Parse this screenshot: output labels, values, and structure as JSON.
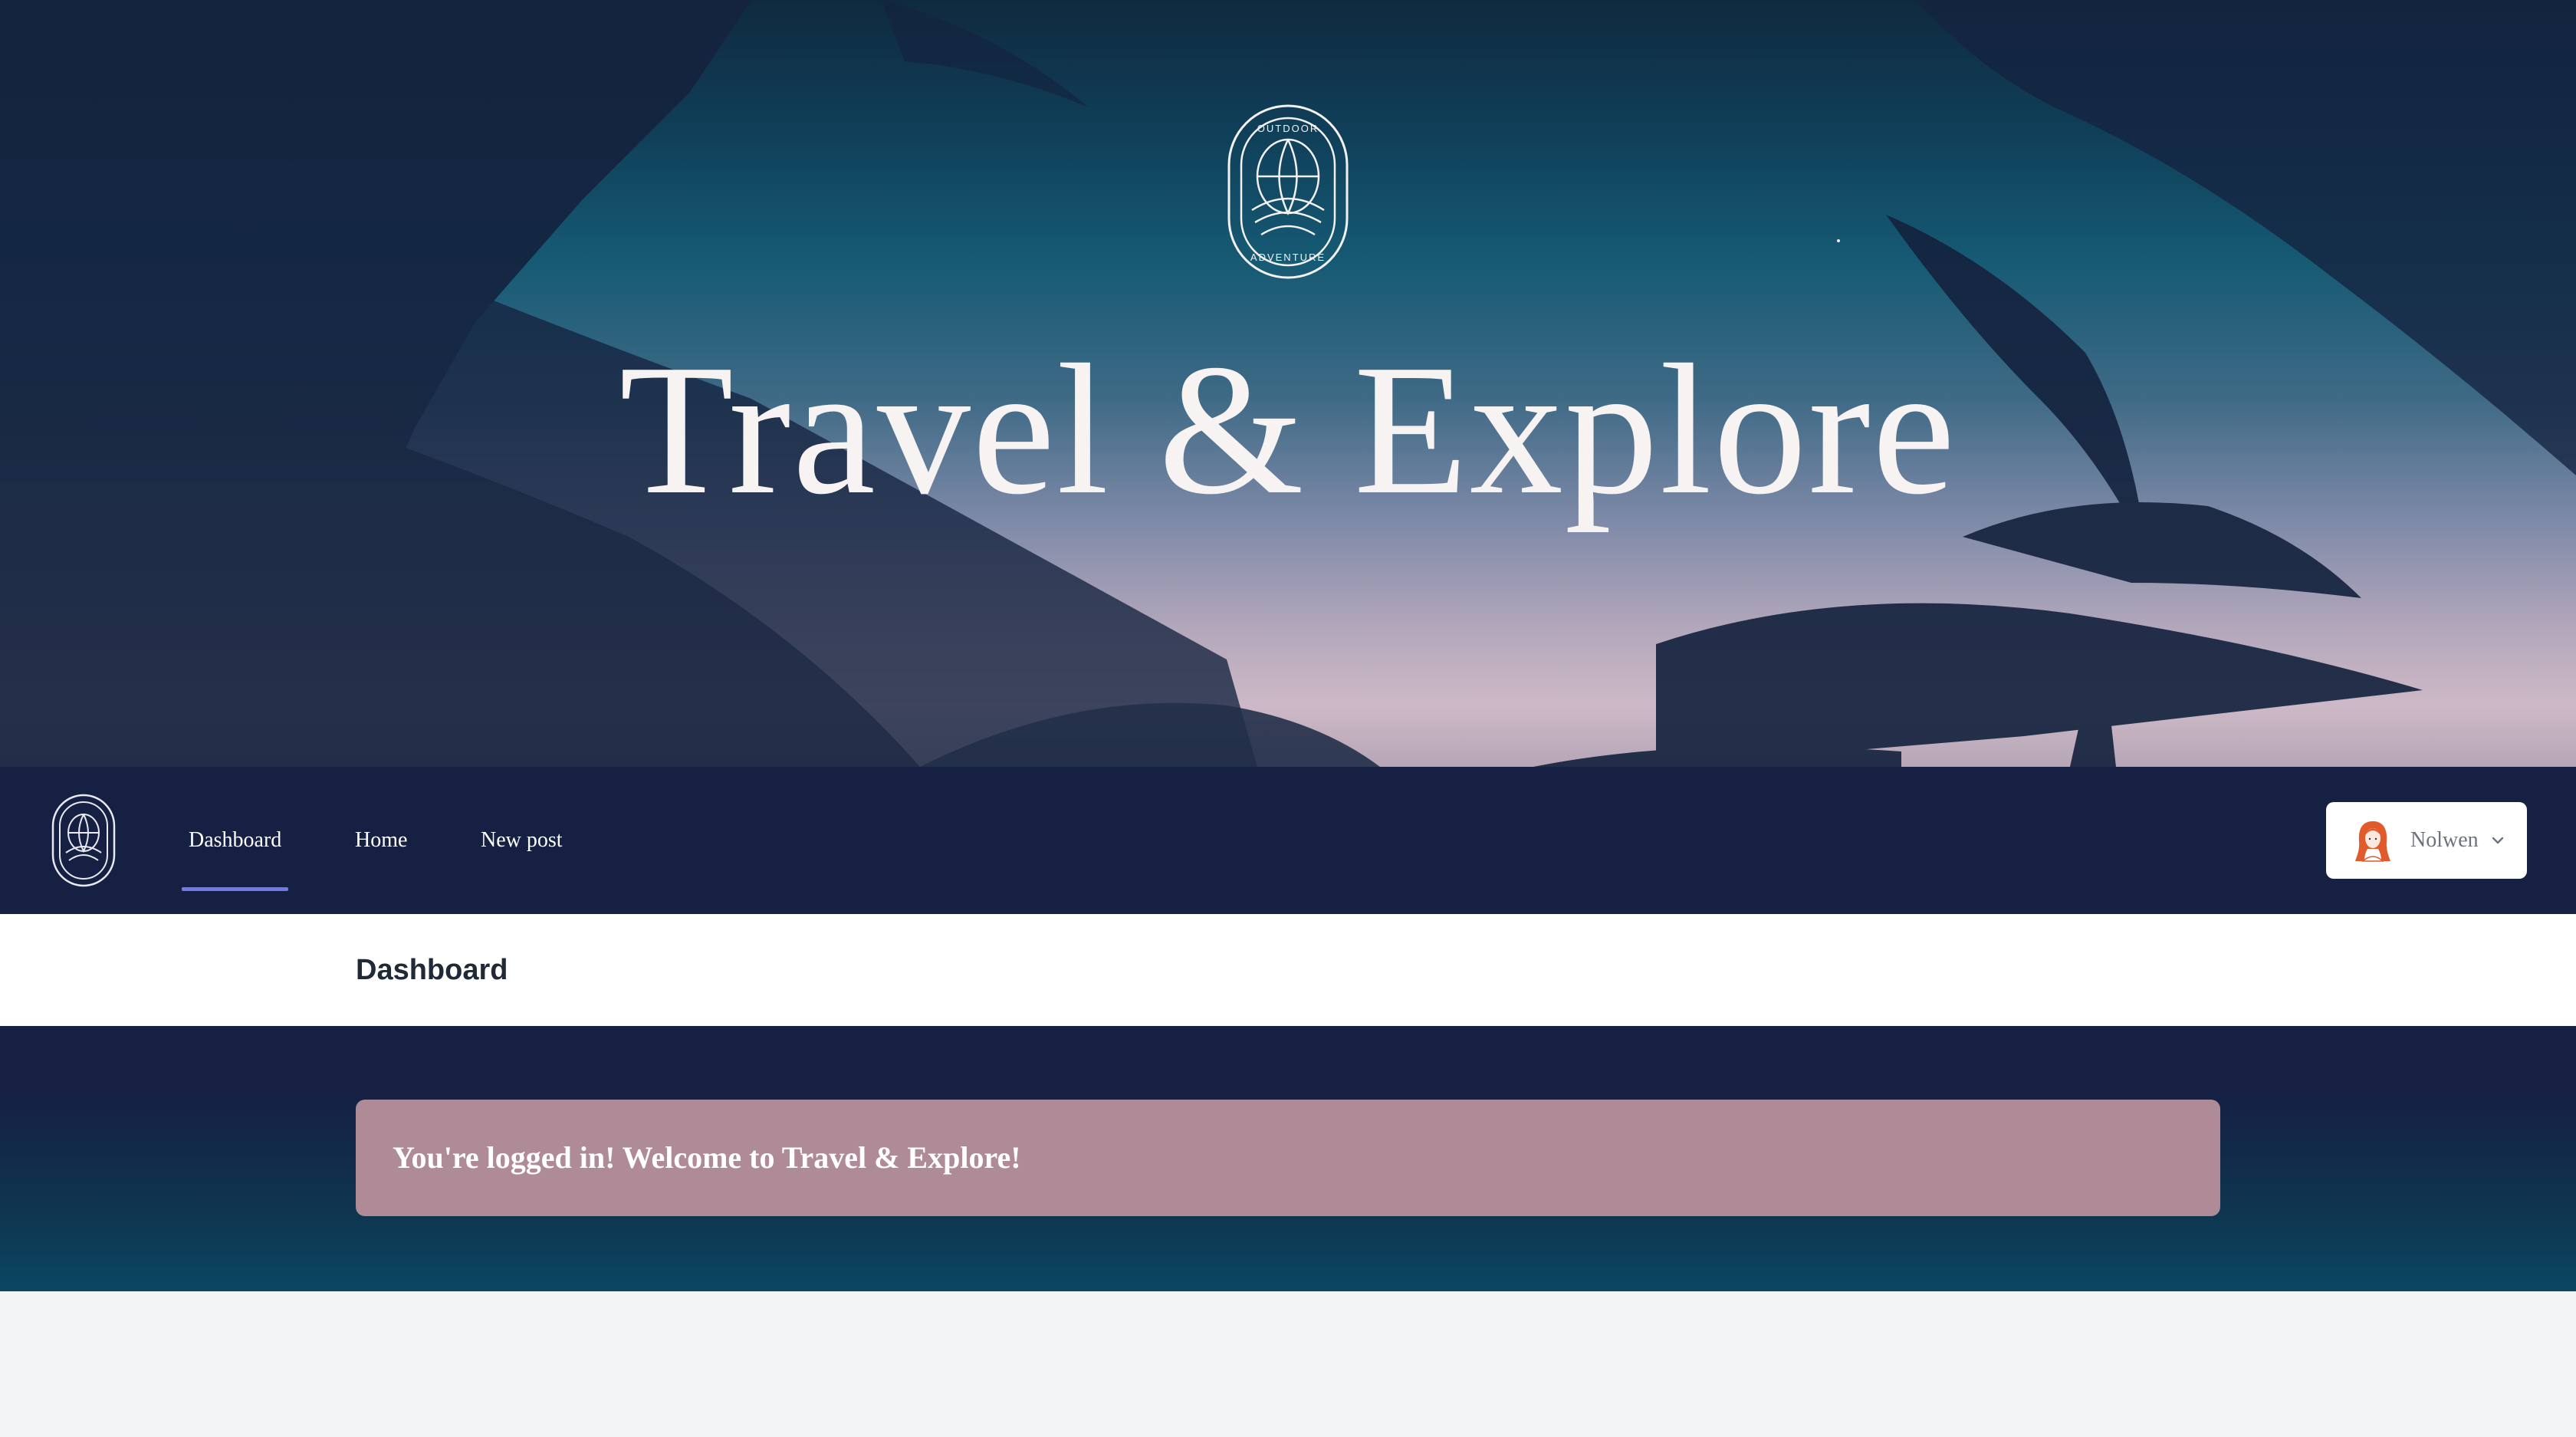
{
  "hero": {
    "title": "Travel & Explore",
    "logo_icon": "outdoor-adventure-badge-icon",
    "logo_text": {
      "top": "OUTDOOR",
      "bottom": "ADVENTURE"
    }
  },
  "nav": {
    "logo_icon": "outdoor-adventure-badge-icon",
    "links": [
      {
        "label": "Dashboard",
        "active": true
      },
      {
        "label": "Home",
        "active": false
      },
      {
        "label": "New post",
        "active": false
      }
    ],
    "user": {
      "name": "Nolwen",
      "avatar_icon": "user-avatar-icon",
      "dropdown_icon": "chevron-down-icon"
    }
  },
  "page": {
    "title": "Dashboard"
  },
  "welcome": {
    "message": "You're logged in! Welcome to Travel & Explore!"
  },
  "colors": {
    "navbar": "#152043",
    "active_underline": "#7477e6",
    "card": "#ae8b97",
    "page_bg": "#f3f4f6"
  }
}
